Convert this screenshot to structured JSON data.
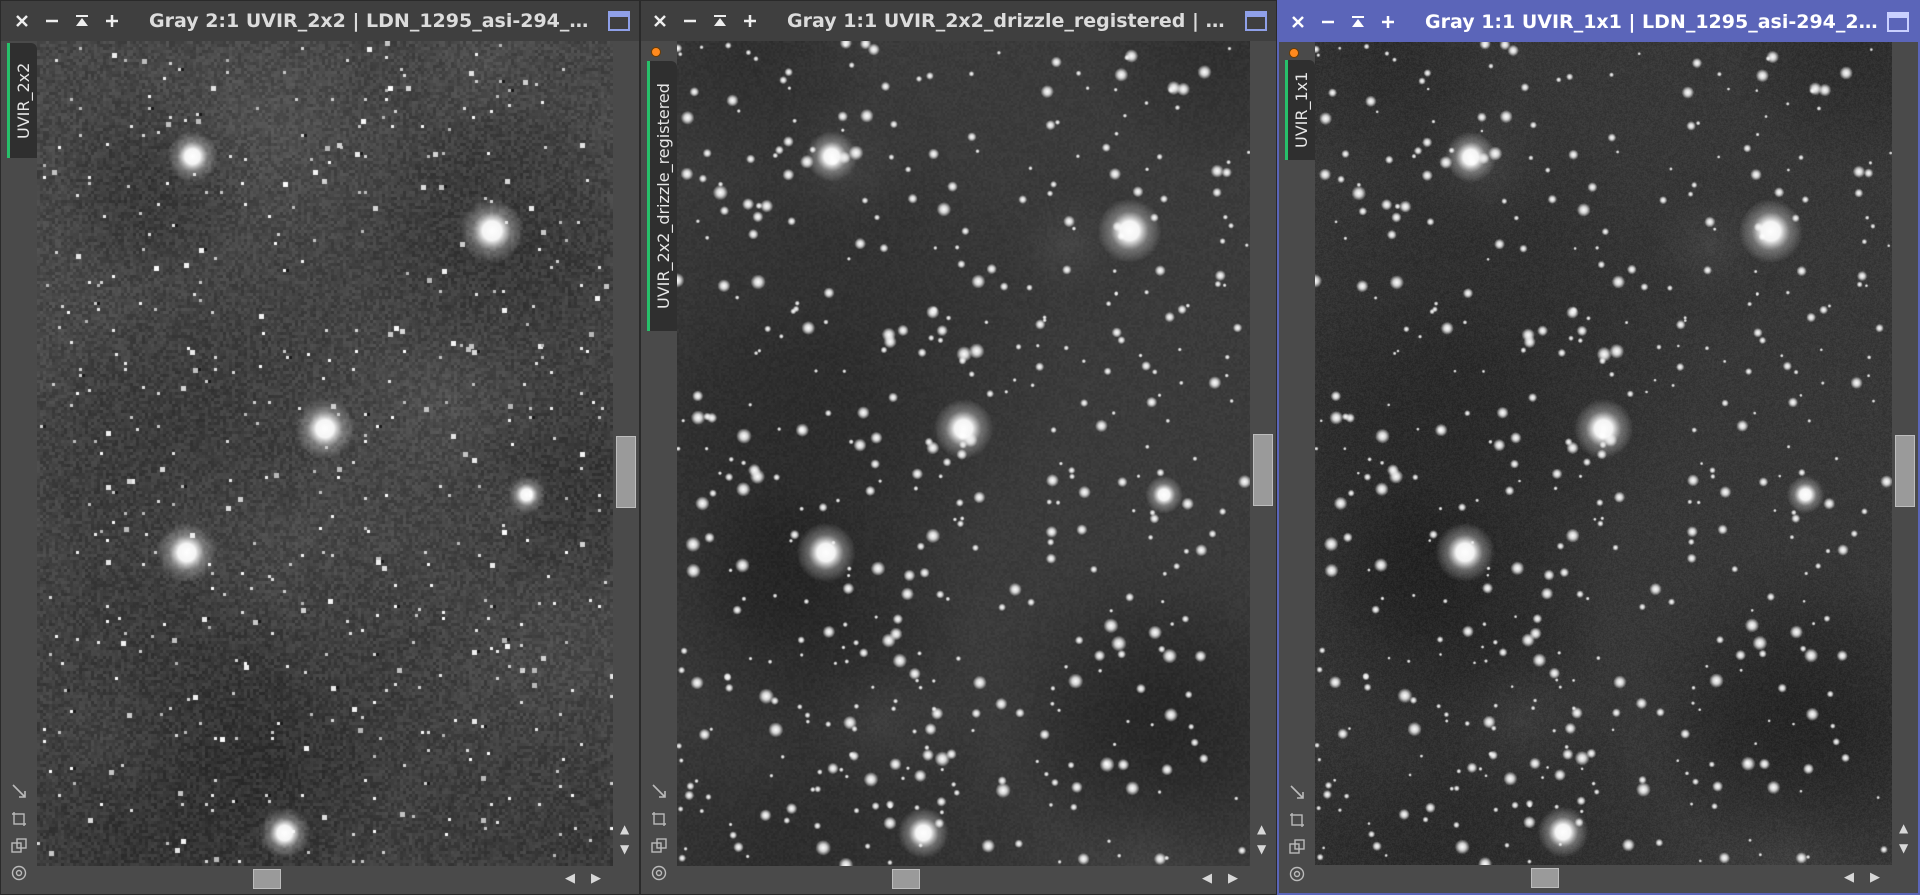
{
  "windows": [
    {
      "title": "Gray 2:1 UVIR_2x2 | LDN_1295_asi-294_2...",
      "tab_label": "UVIR_2x2",
      "active": false,
      "modified_indicator": false,
      "seed": 11,
      "noise": "pixel",
      "brightness": 0.52
    },
    {
      "title": "Gray 1:1 UVIR_2x2_drizzle_registered | <...",
      "tab_label": "UVIR_2x2_drizzle_registered",
      "active": false,
      "modified_indicator": true,
      "seed": 23,
      "noise": "smooth",
      "brightness": 0.42
    },
    {
      "title": "Gray 1:1 UVIR_1x1 | LDN_1295_asi-294_2...",
      "tab_label": "UVIR_1x1",
      "active": true,
      "modified_indicator": true,
      "seed": 23,
      "noise": "fine",
      "brightness": 0.4
    }
  ],
  "icons": {
    "close": "close-icon",
    "minimize": "minimize-icon",
    "shade": "shade-icon",
    "zoom_in": "plus-icon",
    "maximize": "maximize-icon"
  },
  "colors": {
    "active_border": "#5b65b9",
    "tab_accent": "#27c06a",
    "indicator": "#ff8a1e"
  }
}
